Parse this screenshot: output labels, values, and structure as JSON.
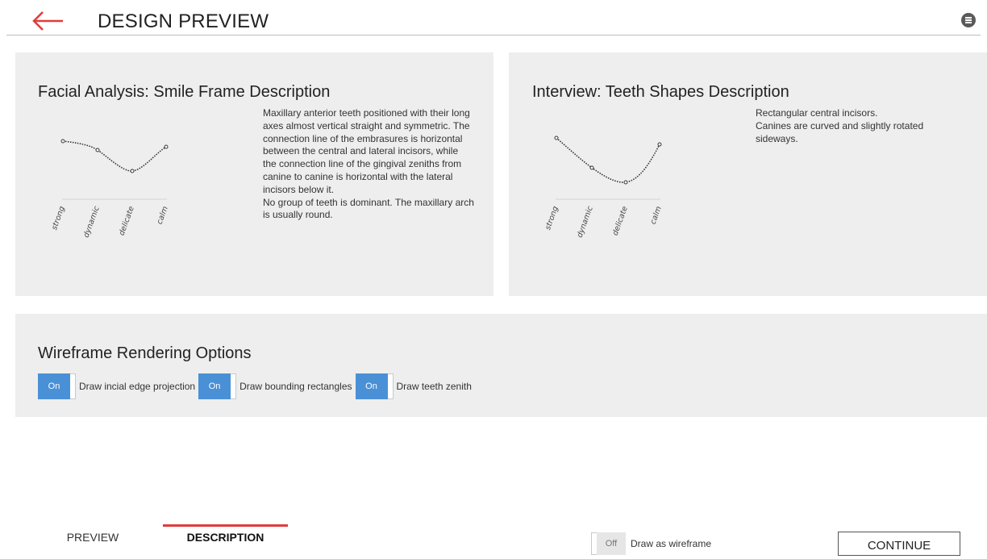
{
  "header": {
    "back_icon": "back-arrow-icon",
    "title": "DESIGN PREVIEW",
    "menu_icon": "menu-icon",
    "accent_color": "#e23b3b"
  },
  "facial": {
    "title": "Facial Analysis: Smile Frame Description",
    "chart": {
      "labels": [
        "strong",
        "dynamic",
        "delicate",
        "calm"
      ]
    },
    "description": [
      "Maxillary anterior teeth positioned with their long axes almost vertical straight and symmetric. The connection line of the embrasures is horizontal between the central and lateral incisors, while the connection line of the gingival zeniths from canine to canine is horizontal with the lateral incisors below it.",
      "No group of teeth is dominant. The maxillary arch is usually round."
    ]
  },
  "interview": {
    "title": "Interview: Teeth Shapes Description",
    "chart": {
      "labels": [
        "strong",
        "dynamic",
        "delicate",
        "calm"
      ]
    },
    "description": [
      "Rectangular central incisors.",
      "Canines are curved and slightly rotated sideways."
    ]
  },
  "wireframe": {
    "title": "Wireframe Rendering Options",
    "options": [
      {
        "state": "On",
        "label": "Draw incial edge projection"
      },
      {
        "state": "On",
        "label": "Draw bounding rectangles"
      },
      {
        "state": "On",
        "label": "Draw teeth zenith"
      }
    ],
    "toggle_color": "#4a90d6"
  },
  "footer": {
    "tabs": [
      {
        "label": "PREVIEW",
        "active": false
      },
      {
        "label": "DESCRIPTION",
        "active": true
      }
    ],
    "wire_toggle": {
      "state": "Off",
      "label": "Draw as wireframe"
    },
    "continue_label": "CONTINUE"
  }
}
